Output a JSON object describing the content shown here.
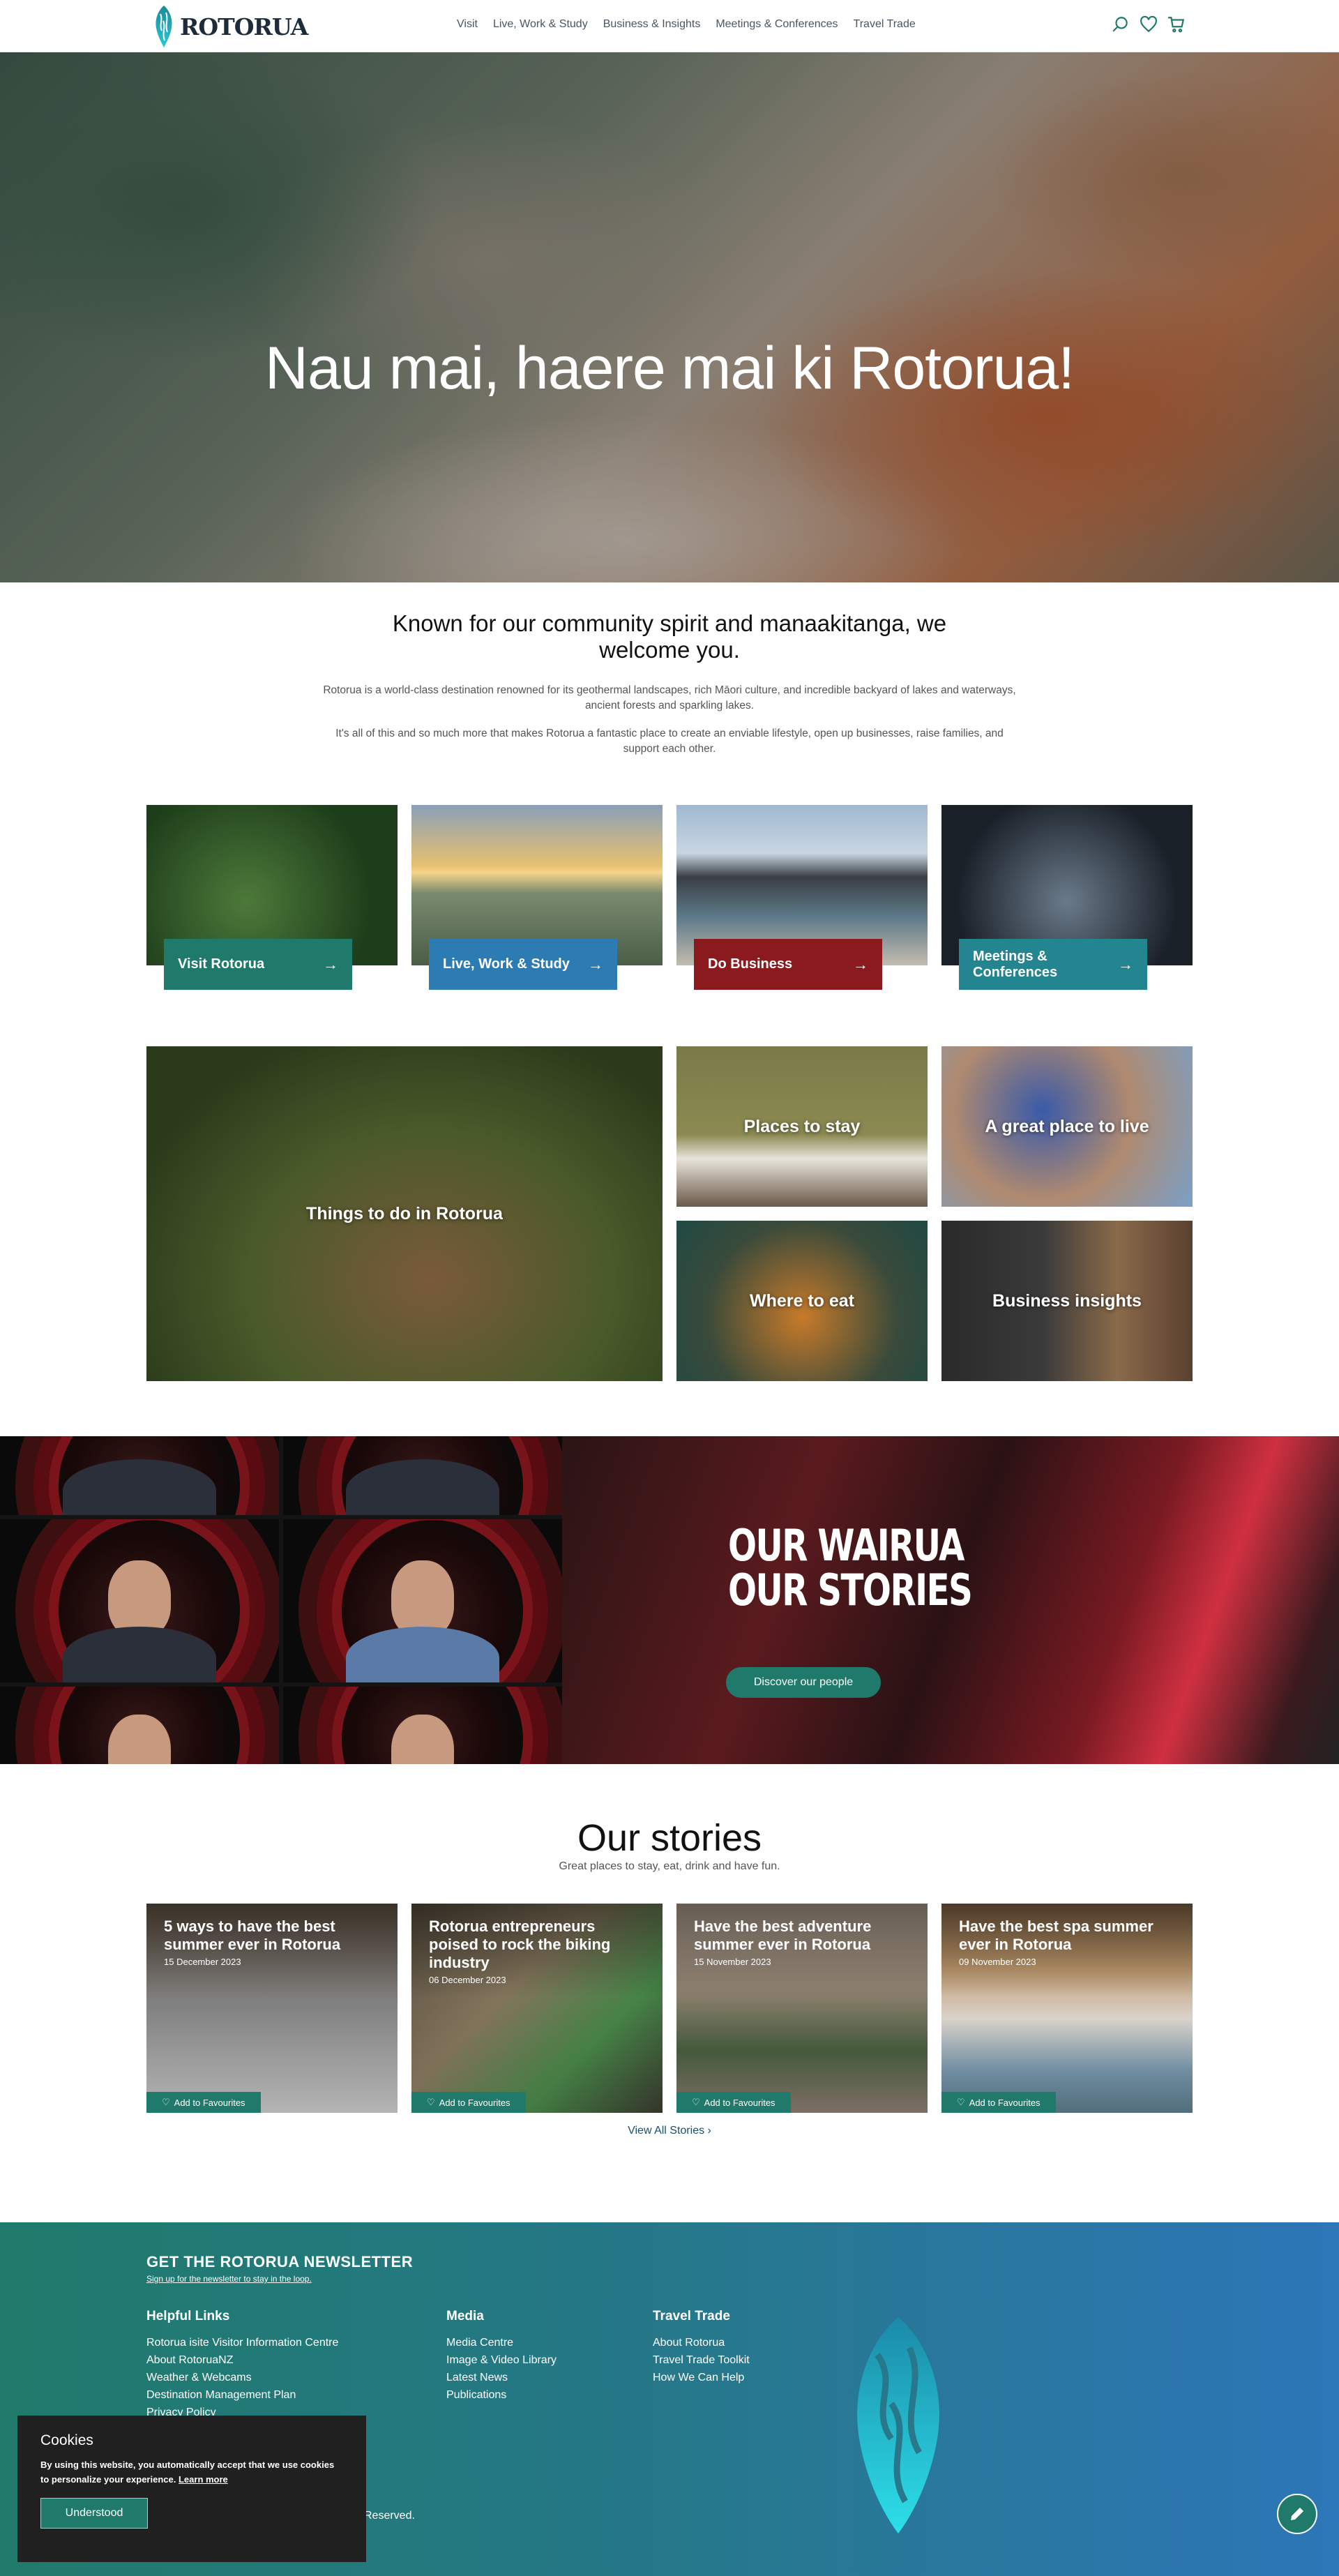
{
  "header": {
    "logo_text": "ROTORUA",
    "nav": [
      "Visit",
      "Live, Work & Study",
      "Business & Insights",
      "Meetings & Conferences",
      "Travel Trade"
    ],
    "icons": [
      "search-icon",
      "heart-icon",
      "cart-icon"
    ]
  },
  "hero": {
    "title": "Nau mai, haere mai ki Rotorua!"
  },
  "intro": {
    "heading": "Known for our community spirit and manaakitanga, we welcome you.",
    "p1": "Rotorua is a world-class destination renowned for its geothermal landscapes, rich Māori culture, and incredible backyard of lakes and waterways, ancient forests and sparkling lakes.",
    "p2": "It's all of this and so much more that makes Rotorua a fantastic place to create an enviable lifestyle, open up businesses, raise families, and support each other."
  },
  "pathways": [
    {
      "label": "Visit Rotorua",
      "color": "#1f7a6b"
    },
    {
      "label": "Live, Work & Study",
      "color": "#2d7bb3"
    },
    {
      "label": "Do Business",
      "color": "#8b1a1e"
    },
    {
      "label": "Meetings & Conferences",
      "color": "#23858f"
    }
  ],
  "mosaic": {
    "things_to_do": "Things to do in Rotorua",
    "places_to_stay": "Places to stay",
    "great_place": "A great place to live",
    "where_to_eat": "Where to eat",
    "business_insights": "Business insights"
  },
  "wairua": {
    "line1": "OUR WAIRUA",
    "line2": "OUR STORIES",
    "button": "Discover our people"
  },
  "stories": {
    "title": "Our stories",
    "subtitle": "Great places to stay, eat, drink and have fun.",
    "fav_label": "Add to Favourites",
    "view_all": "View All Stories",
    "items": [
      {
        "title": "5 ways to have the best summer ever in Rotorua",
        "date": "15 December 2023"
      },
      {
        "title": "Rotorua entrepreneurs poised to rock the biking industry",
        "date": "06 December 2023"
      },
      {
        "title": "Have the best adventure summer ever in Rotorua",
        "date": "15 November 2023"
      },
      {
        "title": "Have the best spa summer ever in Rotorua",
        "date": "09 November 2023"
      }
    ]
  },
  "footer": {
    "newsletter_title": "GET THE ROTORUA NEWSLETTER",
    "newsletter_sub": "Sign up for the newsletter to stay in the loop.",
    "col1": {
      "title": "Helpful Links",
      "items": [
        "Rotorua isite Visitor Information Centre",
        "About RotoruaNZ",
        "Weather & Webcams",
        "Destination Management Plan",
        "Privacy Policy"
      ]
    },
    "col2": {
      "title": "Media",
      "items": [
        "Media Centre",
        "Image & Video Library",
        "Latest News",
        "Publications"
      ]
    },
    "col3": {
      "title": "Travel Trade",
      "items": [
        "About Rotorua",
        "Travel Trade Toolkit",
        "How We Can Help"
      ]
    },
    "reserved": "Reserved."
  },
  "cookie": {
    "title": "Cookies",
    "text": "By using this website, you automatically accept that we use cookies to personalize your experience.",
    "learn_more": "Learn more",
    "button": "Understood"
  }
}
